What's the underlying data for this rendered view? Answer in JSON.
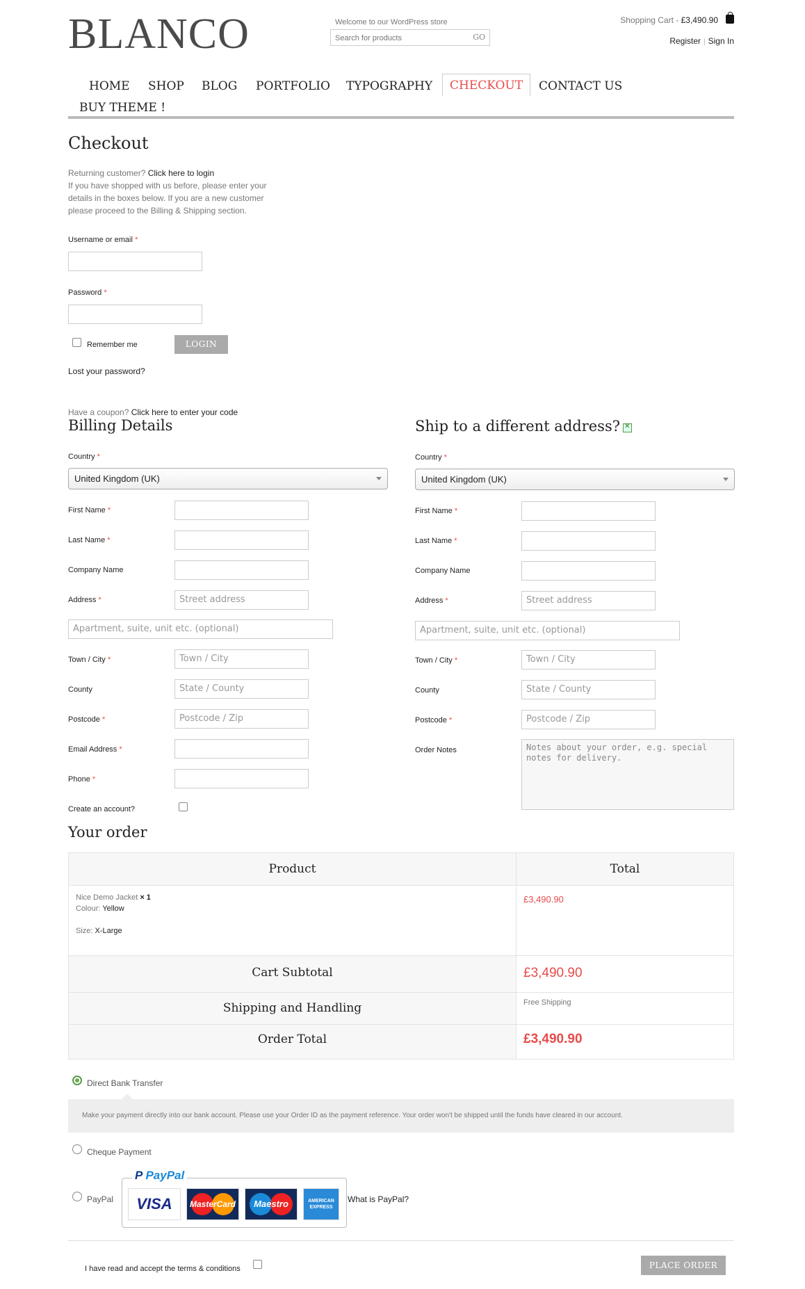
{
  "header": {
    "logo": "BLANCO",
    "welcome": "Welcome to our WordPress store",
    "search_placeholder": "Search for products",
    "search_button": "GO",
    "cart_label": "Shopping Cart - ",
    "cart_total": "£3,490.90",
    "register": "Register",
    "sign_in": "Sign In"
  },
  "nav": [
    "HOME",
    "SHOP",
    "BLOG",
    "PORTFOLIO",
    "TYPOGRAPHY",
    "CHECKOUT",
    "CONTACT US",
    "BUY THEME !"
  ],
  "page_title": "Checkout",
  "login": {
    "returning": "Returning customer?",
    "click_login": "Click here to login",
    "intro": "If you have shopped with us before, please enter your details in the boxes below. If you are a new customer please proceed to the Billing & Shipping section.",
    "username_label": "Username or email",
    "password_label": "Password",
    "remember": "Remember me",
    "login_button": "LOGIN",
    "lost": "Lost your password?"
  },
  "coupon": {
    "prompt": "Have a coupon?",
    "link": "Click here to enter your code"
  },
  "billing": {
    "title": "Billing Details",
    "country_label": "Country",
    "country_value": "United Kingdom (UK)",
    "first_name": "First Name",
    "last_name": "Last Name",
    "company": "Company Name",
    "address": "Address",
    "street_ph": "Street address",
    "apt_ph": "Apartment, suite, unit etc. (optional)",
    "town": "Town / City",
    "town_ph": "Town / City",
    "county": "County",
    "county_ph": "State / County",
    "postcode": "Postcode",
    "postcode_ph": "Postcode / Zip",
    "email": "Email Address",
    "phone": "Phone",
    "create_account": "Create an account?"
  },
  "shipping": {
    "title": "Ship to a different address?",
    "country_label": "Country",
    "country_value": "United Kingdom (UK)",
    "first_name": "First Name",
    "last_name": "Last Name",
    "company": "Company Name",
    "address": "Address",
    "street_ph": "Street address",
    "apt_ph": "Apartment, suite, unit etc. (optional)",
    "town": "Town / City",
    "town_ph": "Town / City",
    "county": "County",
    "county_ph": "State / County",
    "postcode": "Postcode",
    "postcode_ph": "Postcode / Zip",
    "notes": "Order Notes",
    "notes_ph": "Notes about your order, e.g. special notes for delivery."
  },
  "order": {
    "title": "Your order",
    "col_product": "Product",
    "col_total": "Total",
    "item_name": "Nice Demo Jacket",
    "item_qty": "× 1",
    "colour_label": "Colour:",
    "colour_value": "Yellow",
    "size_label": "Size:",
    "size_value": "X-Large",
    "item_total": "£3,490.90",
    "subtotal_label": "Cart Subtotal",
    "subtotal_value": "£3,490.90",
    "shipping_label": "Shipping and Handling",
    "shipping_value": "Free Shipping",
    "total_label": "Order Total",
    "total_value": "£3,490.90"
  },
  "payment": {
    "bank": "Direct Bank Transfer",
    "bank_desc": "Make your payment directly into our bank account. Please use your Order ID as the payment reference. Your order won't be shipped until the funds have cleared in our account.",
    "cheque": "Cheque Payment",
    "paypal": "PayPal",
    "paypal_logo": "PayPal",
    "cards": [
      "VISA",
      "MasterCard",
      "Maestro",
      "AMERICAN EXPRESS"
    ],
    "what_paypal": "What is PayPal?",
    "terms": "I have read and accept the terms & conditions",
    "place_order": "PLACE ORDER"
  },
  "colors": {
    "accent": "#e84b4b",
    "button": "#aaaaaa",
    "radio_on": "#6aaa4a"
  },
  "icons": [
    "shopping-bag-icon",
    "dropdown-arrow-icon",
    "checkbox-icon",
    "radio-icon",
    "paypal-logo-icon"
  ]
}
